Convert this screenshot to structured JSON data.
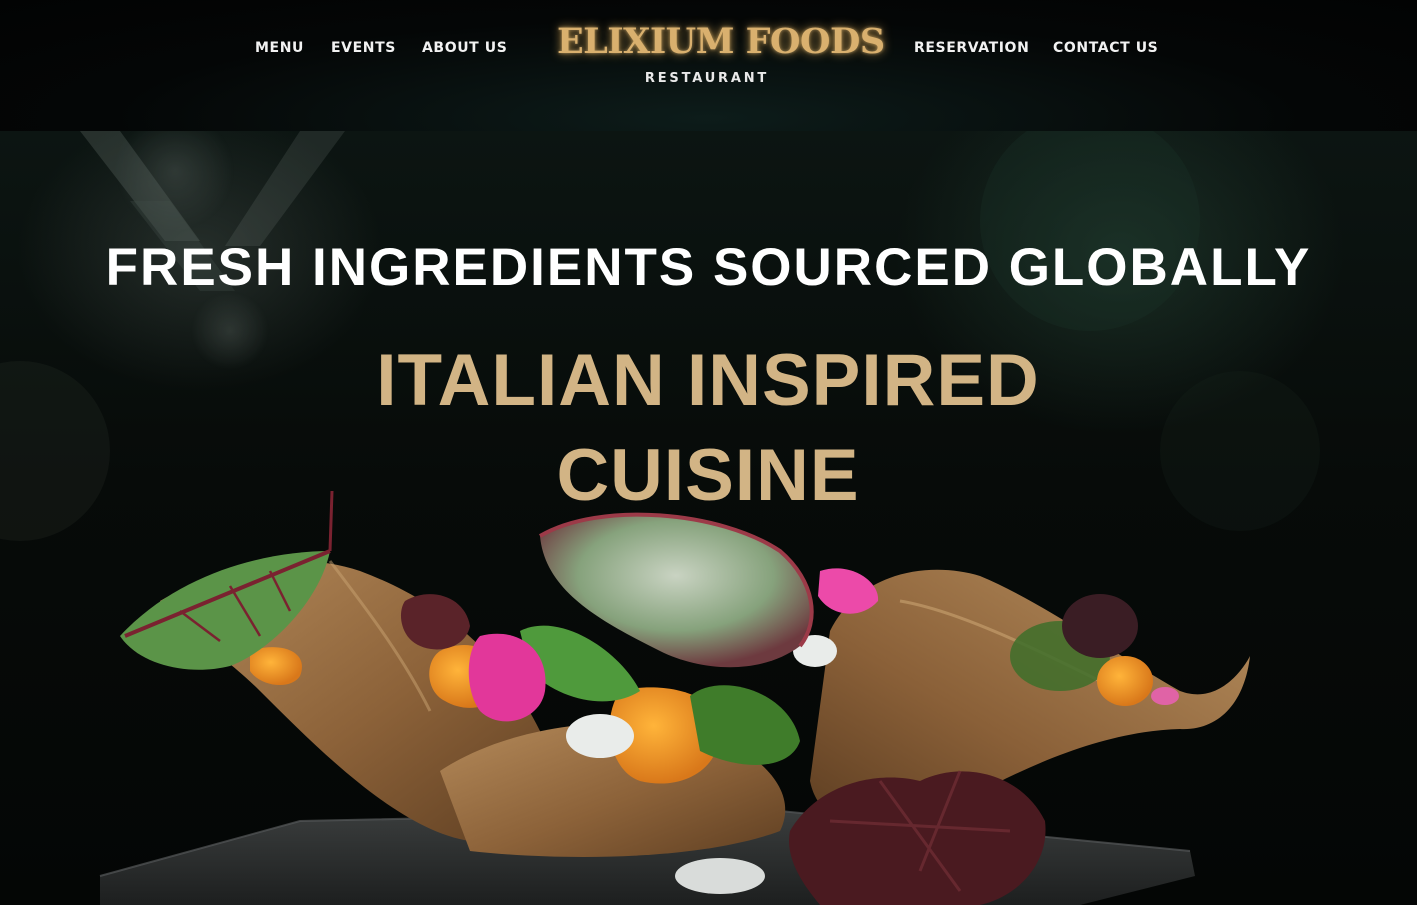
{
  "header": {
    "nav_left": [
      "MENU",
      "EVENTS",
      "ABOUT US"
    ],
    "nav_right": [
      "RESERVATION",
      "CONTACT US"
    ],
    "brand": {
      "name": "ELIXIUM FOODS",
      "tagline": "RESTAURANT",
      "color": "#d9b06e"
    }
  },
  "hero": {
    "headline": "FRESH INGREDIENTS SOURCED GLOBALLY",
    "title_line1": "ITALIAN INSPIRED",
    "title_line2": "CUISINE",
    "title_color": "#d2b485"
  }
}
